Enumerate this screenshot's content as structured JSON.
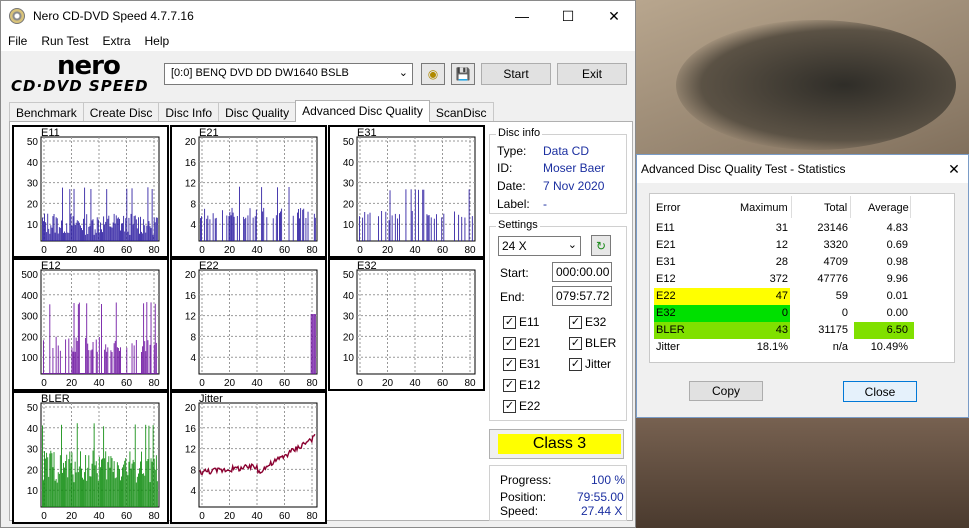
{
  "main_window": {
    "title": "Nero CD-DVD Speed 4.7.7.16",
    "menu": [
      "File",
      "Run Test",
      "Extra",
      "Help"
    ],
    "logo_top": "nero",
    "logo_bottom": "CD·DVD SPEED",
    "drive": "[0:0]   BENQ DVD DD DW1640 BSLB",
    "start_label": "Start",
    "exit_label": "Exit",
    "tabs": [
      "Benchmark",
      "Create Disc",
      "Disc Info",
      "Disc Quality",
      "Advanced Disc Quality",
      "ScanDisc"
    ],
    "active_tab": "Advanced Disc Quality"
  },
  "graphs": [
    {
      "label": "E11",
      "y_ticks": [
        "50",
        "40",
        "30",
        "20",
        "10"
      ],
      "x_ticks": [
        "0",
        "20",
        "40",
        "60",
        "80"
      ],
      "color": "#2a1aa0",
      "ymax": 50
    },
    {
      "label": "E21",
      "y_ticks": [
        "20",
        "16",
        "12",
        "8",
        "4"
      ],
      "x_ticks": [
        "0",
        "20",
        "40",
        "60",
        "80"
      ],
      "color": "#2a1aa0",
      "ymax": 20
    },
    {
      "label": "E31",
      "y_ticks": [
        "50",
        "40",
        "30",
        "20",
        "10"
      ],
      "x_ticks": [
        "0",
        "20",
        "40",
        "60",
        "80"
      ],
      "color": "#2a1aa0",
      "ymax": 50
    },
    {
      "label": "E12",
      "y_ticks": [
        "500",
        "400",
        "300",
        "200",
        "100"
      ],
      "x_ticks": [
        "0",
        "20",
        "40",
        "60",
        "80"
      ],
      "color": "#6b0fa0",
      "ymax": 500
    },
    {
      "label": "E22",
      "y_ticks": [
        "20",
        "16",
        "12",
        "8",
        "4"
      ],
      "x_ticks": [
        "0",
        "20",
        "40",
        "60",
        "80"
      ],
      "color": "#6b0fa0",
      "ymax": 20
    },
    {
      "label": "E32",
      "y_ticks": [
        "50",
        "40",
        "30",
        "20",
        "10"
      ],
      "x_ticks": [
        "0",
        "20",
        "40",
        "60",
        "80"
      ],
      "color": "#6b0fa0",
      "ymax": 50
    },
    {
      "label": "BLER",
      "y_ticks": [
        "50",
        "40",
        "30",
        "20",
        "10"
      ],
      "x_ticks": [
        "0",
        "20",
        "40",
        "60",
        "80"
      ],
      "color": "#0a8a0a",
      "ymax": 50
    },
    {
      "label": "Jitter",
      "y_ticks": [
        "20",
        "16",
        "12",
        "8",
        "4"
      ],
      "x_ticks": [
        "0",
        "20",
        "40",
        "60",
        "80"
      ],
      "color": "#8a0030",
      "ymax": 20
    }
  ],
  "disc_info": {
    "legend": "Disc info",
    "type_label": "Type:",
    "type": "Data CD",
    "id_label": "ID:",
    "id": "Moser Baer",
    "date_label": "Date:",
    "date": "7 Nov 2020",
    "label_label": "Label:",
    "label": "-"
  },
  "settings": {
    "legend": "Settings",
    "speed": "24 X",
    "start_label": "Start:",
    "start": "000:00.00",
    "end_label": "End:",
    "end": "079:57.72",
    "checks": [
      {
        "label": "E11",
        "checked": true
      },
      {
        "label": "E32",
        "checked": true
      },
      {
        "label": "E21",
        "checked": true
      },
      {
        "label": "BLER",
        "checked": true
      },
      {
        "label": "E31",
        "checked": true
      },
      {
        "label": "Jitter",
        "checked": true
      },
      {
        "label": "E12",
        "checked": true
      },
      {
        "label": "E22",
        "checked": true
      }
    ]
  },
  "class_label": "Class 3",
  "progress": {
    "progress_label": "Progress:",
    "progress": "100 %",
    "position_label": "Position:",
    "position": "79:55.00",
    "speed_label": "Speed:",
    "speed": "27.44 X"
  },
  "stats_window": {
    "title": "Advanced Disc Quality Test - Statistics",
    "headers": [
      "Error",
      "Maximum",
      "Total",
      "Average"
    ],
    "rows": [
      {
        "error": "E11",
        "maximum": "31",
        "total": "23146",
        "average": "4.83",
        "max_hl": "",
        "avg_hl": ""
      },
      {
        "error": "E21",
        "maximum": "12",
        "total": "3320",
        "average": "0.69",
        "max_hl": "",
        "avg_hl": ""
      },
      {
        "error": "E31",
        "maximum": "28",
        "total": "4709",
        "average": "0.98",
        "max_hl": "",
        "avg_hl": ""
      },
      {
        "error": "E12",
        "maximum": "372",
        "total": "47776",
        "average": "9.96",
        "max_hl": "",
        "avg_hl": ""
      },
      {
        "error": "E22",
        "maximum": "47",
        "total": "59",
        "average": "0.01",
        "max_hl": "#ffff00",
        "avg_hl": ""
      },
      {
        "error": "E32",
        "maximum": "0",
        "total": "0",
        "average": "0.00",
        "max_hl": "#00e000",
        "avg_hl": ""
      },
      {
        "error": "BLER",
        "maximum": "43",
        "total": "31175",
        "average": "6.50",
        "max_hl": "#80e000",
        "avg_hl": "#80e000"
      },
      {
        "error": "Jitter",
        "maximum": "18.1%",
        "total": "n/a",
        "average": "10.49%",
        "max_hl": "",
        "avg_hl": ""
      }
    ],
    "copy_label": "Copy",
    "close_label": "Close"
  }
}
